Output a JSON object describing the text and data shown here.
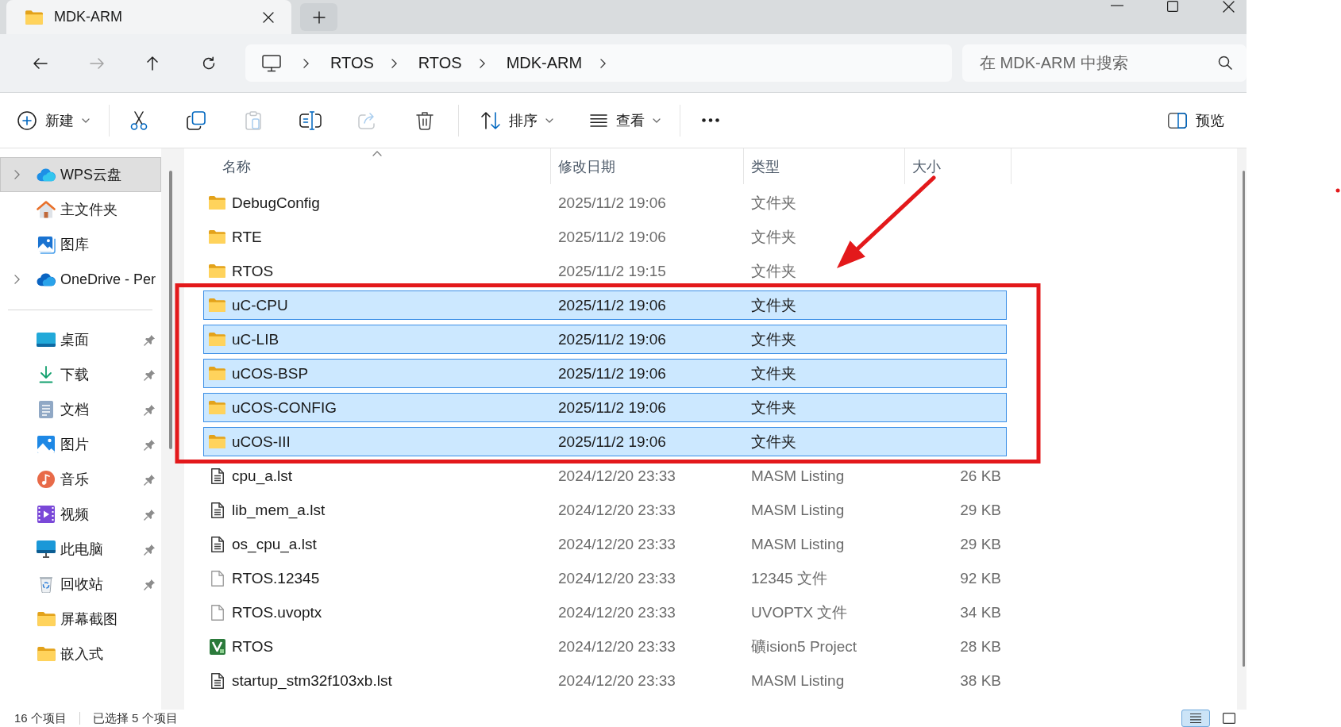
{
  "tabs": [
    {
      "label": "MDK-ARM",
      "selected": true
    }
  ],
  "navigation": [
    {
      "kind": "back",
      "disabled": false
    },
    {
      "kind": "forward",
      "disabled": true
    },
    {
      "kind": "up",
      "disabled": false
    },
    {
      "kind": "refresh",
      "disabled": false
    }
  ],
  "breadcrumb": [
    "RTOS",
    "RTOS",
    "MDK-ARM"
  ],
  "search": {
    "placeholder": "在 MDK-ARM 中搜索"
  },
  "toolbar": {
    "items": [
      {
        "kind": "new",
        "label": "新建",
        "disabled": false
      },
      {
        "kind": "separator"
      },
      {
        "kind": "cut",
        "disabled": false
      },
      {
        "kind": "copy",
        "disabled": false
      },
      {
        "kind": "paste",
        "disabled": true
      },
      {
        "kind": "rename",
        "disabled": false
      },
      {
        "kind": "share",
        "disabled": true
      },
      {
        "kind": "delete",
        "disabled": false
      },
      {
        "kind": "separator"
      },
      {
        "kind": "sort",
        "label": "排序",
        "disabled": false
      },
      {
        "kind": "view",
        "label": "查看",
        "disabled": false
      },
      {
        "kind": "separator"
      },
      {
        "kind": "more",
        "disabled": false
      }
    ],
    "preview": {
      "label": "预览"
    }
  },
  "sidebar": {
    "groups": [
      {
        "items": [
          {
            "kind": "wps-cloud",
            "label": "WPS云盘",
            "expandable": true,
            "pinned": false,
            "selected": true
          },
          {
            "kind": "home",
            "label": "主文件夹",
            "expandable": false,
            "pinned": false,
            "selected": false
          },
          {
            "kind": "gallery",
            "label": "图库",
            "expandable": false,
            "pinned": false,
            "selected": false
          },
          {
            "kind": "onedrive",
            "label": "OneDrive - Per",
            "expandable": true,
            "pinned": false,
            "selected": false
          }
        ]
      },
      {
        "items": [
          {
            "kind": "desktop",
            "label": "桌面",
            "expandable": false,
            "pinned": true,
            "selected": false
          },
          {
            "kind": "download",
            "label": "下载",
            "expandable": false,
            "pinned": true,
            "selected": false
          },
          {
            "kind": "documents",
            "label": "文档",
            "expandable": false,
            "pinned": true,
            "selected": false
          },
          {
            "kind": "pictures",
            "label": "图片",
            "expandable": false,
            "pinned": true,
            "selected": false
          },
          {
            "kind": "music",
            "label": "音乐",
            "expandable": false,
            "pinned": true,
            "selected": false
          },
          {
            "kind": "videos",
            "label": "视频",
            "expandable": false,
            "pinned": true,
            "selected": false
          },
          {
            "kind": "computer",
            "label": "此电脑",
            "expandable": false,
            "pinned": true,
            "selected": false
          },
          {
            "kind": "recycle",
            "label": "回收站",
            "expandable": false,
            "pinned": true,
            "selected": false
          },
          {
            "kind": "folder",
            "label": "屏幕截图",
            "expandable": false,
            "pinned": false,
            "selected": false
          },
          {
            "kind": "folder",
            "label": "嵌入式",
            "expandable": false,
            "pinned": false,
            "selected": false
          }
        ]
      }
    ]
  },
  "file_list": {
    "columns": [
      {
        "label": "名称",
        "sorted": true
      },
      {
        "label": "修改日期",
        "sorted": false
      },
      {
        "label": "类型",
        "sorted": false
      },
      {
        "label": "大小",
        "sorted": false
      }
    ],
    "rows": [
      {
        "kind": "folder",
        "name": "DebugConfig",
        "date": "2025/11/2 19:06",
        "type": "文件夹",
        "selected": false
      },
      {
        "kind": "folder",
        "name": "RTE",
        "date": "2025/11/2 19:06",
        "type": "文件夹",
        "selected": false
      },
      {
        "kind": "folder",
        "name": "RTOS",
        "date": "2025/11/2 19:15",
        "type": "文件夹",
        "selected": false
      },
      {
        "kind": "folder",
        "name": "uC-CPU",
        "date": "2025/11/2 19:06",
        "type": "文件夹",
        "selected": true
      },
      {
        "kind": "folder",
        "name": "uC-LIB",
        "date": "2025/11/2 19:06",
        "type": "文件夹",
        "selected": true
      },
      {
        "kind": "folder",
        "name": "uCOS-BSP",
        "date": "2025/11/2 19:06",
        "type": "文件夹",
        "selected": true
      },
      {
        "kind": "folder",
        "name": "uCOS-CONFIG",
        "date": "2025/11/2 19:06",
        "type": "文件夹",
        "selected": true
      },
      {
        "kind": "folder",
        "name": "uCOS-III",
        "date": "2025/11/2 19:06",
        "type": "文件夹",
        "selected": true
      },
      {
        "kind": "listing",
        "name": "cpu_a.lst",
        "date": "2024/12/20 23:33",
        "type": "MASM Listing",
        "size": "26 KB",
        "selected": false
      },
      {
        "kind": "listing",
        "name": "lib_mem_a.lst",
        "date": "2024/12/20 23:33",
        "type": "MASM Listing",
        "size": "29 KB",
        "selected": false
      },
      {
        "kind": "listing",
        "name": "os_cpu_a.lst",
        "date": "2024/12/20 23:33",
        "type": "MASM Listing",
        "size": "29 KB",
        "selected": false
      },
      {
        "kind": "file",
        "name": "RTOS.12345",
        "date": "2024/12/20 23:33",
        "type": "12345 文件",
        "size": "92 KB",
        "selected": false
      },
      {
        "kind": "file",
        "name": "RTOS.uvoptx",
        "date": "2024/12/20 23:33",
        "type": "UVOPTX 文件",
        "size": "34 KB",
        "selected": false
      },
      {
        "kind": "project",
        "name": "RTOS",
        "date": "2024/12/20 23:33",
        "type": "礦ision5 Project",
        "size": "28 KB",
        "selected": false
      },
      {
        "kind": "listing",
        "name": "startup_stm32f103xb.lst",
        "date": "2024/12/20 23:33",
        "type": "MASM Listing",
        "size": "38 KB",
        "selected": false
      }
    ]
  },
  "status_bar": {
    "item_count": "16 个项目",
    "selection": "已选择 5 个项目"
  },
  "view_modes": [
    {
      "kind": "details",
      "selected": true
    },
    {
      "kind": "tiles",
      "selected": false
    }
  ]
}
